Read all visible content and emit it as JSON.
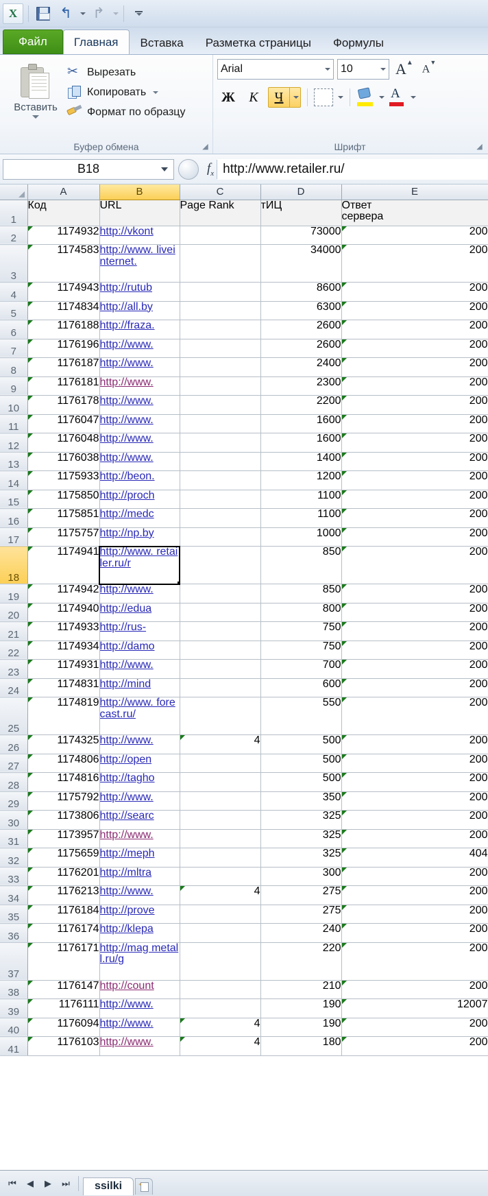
{
  "app": {
    "logo": "X",
    "quick_access": [
      {
        "name": "save-button",
        "label": "Сохранить"
      },
      {
        "name": "undo-button",
        "label": "Отменить"
      },
      {
        "name": "redo-button",
        "label": "Вернуть"
      },
      {
        "name": "customize-qat-button",
        "label": "Настройка панели быстрого доступа"
      }
    ]
  },
  "ribbon": {
    "tabs": [
      {
        "label": "Файл",
        "type": "file"
      },
      {
        "label": "Главная",
        "type": "active"
      },
      {
        "label": "Вставка",
        "type": "normal"
      },
      {
        "label": "Разметка страницы",
        "type": "normal"
      },
      {
        "label": "Формулы",
        "type": "normal"
      }
    ],
    "clipboard": {
      "group_title": "Буфер обмена",
      "paste_label": "Вставить",
      "items": [
        {
          "label": "Вырезать",
          "icon": "scissors-icon",
          "has_menu": false
        },
        {
          "label": "Копировать",
          "icon": "copy-icon",
          "has_menu": true
        },
        {
          "label": "Формат по образцу",
          "icon": "format-painter-icon",
          "has_menu": false
        }
      ]
    },
    "font": {
      "group_title": "Шрифт",
      "font_name": "Arial",
      "font_size": "10",
      "grow_label": "A",
      "shrink_label": "A",
      "bold_label": "Ж",
      "italic_label": "К",
      "underline_label": "Ч",
      "underline_active": true
    }
  },
  "formula_bar": {
    "name_box": "B18",
    "fx_label": "fx",
    "formula_value": "http://www.retailer.ru/"
  },
  "grid": {
    "columns": [
      "A",
      "B",
      "C",
      "D",
      "E"
    ],
    "selected_column": "B",
    "selected_row": 18,
    "selected_cell": "B18",
    "headers": {
      "A": "Код",
      "B": "URL",
      "C": "Page Rank",
      "D": "тИЦ",
      "E": "Ответ\nсервера"
    },
    "rows": [
      {
        "n": 2,
        "a": "1174932",
        "b": "http://vkont",
        "b_visited": false,
        "c": "",
        "d": "73000",
        "e": "200"
      },
      {
        "n": 3,
        "a": "1174583",
        "b": "http://www. liveinternet.",
        "b_visited": false,
        "c": "",
        "d": "34000",
        "e": "200",
        "tall": true
      },
      {
        "n": 4,
        "a": "1174943",
        "b": "http://rutub",
        "b_visited": false,
        "c": "",
        "d": "8600",
        "e": "200"
      },
      {
        "n": 5,
        "a": "1174834",
        "b": "http://all.by",
        "b_visited": false,
        "c": "",
        "d": "6300",
        "e": "200"
      },
      {
        "n": 6,
        "a": "1176188",
        "b": "http://fraza.",
        "b_visited": false,
        "c": "",
        "d": "2600",
        "e": "200"
      },
      {
        "n": 7,
        "a": "1176196",
        "b": "http://www.",
        "b_visited": false,
        "c": "",
        "d": "2600",
        "e": "200"
      },
      {
        "n": 8,
        "a": "1176187",
        "b": "http://www.",
        "b_visited": false,
        "c": "",
        "d": "2400",
        "e": "200"
      },
      {
        "n": 9,
        "a": "1176181",
        "b": "http://www.",
        "b_visited": true,
        "c": "",
        "d": "2300",
        "e": "200"
      },
      {
        "n": 10,
        "a": "1176178",
        "b": "http://www.",
        "b_visited": false,
        "c": "",
        "d": "2200",
        "e": "200"
      },
      {
        "n": 11,
        "a": "1176047",
        "b": "http://www.",
        "b_visited": false,
        "c": "",
        "d": "1600",
        "e": "200"
      },
      {
        "n": 12,
        "a": "1176048",
        "b": "http://www.",
        "b_visited": false,
        "c": "",
        "d": "1600",
        "e": "200"
      },
      {
        "n": 13,
        "a": "1176038",
        "b": "http://www.",
        "b_visited": false,
        "c": "",
        "d": "1400",
        "e": "200"
      },
      {
        "n": 14,
        "a": "1175933",
        "b": "http://beon.",
        "b_visited": false,
        "c": "",
        "d": "1200",
        "e": "200"
      },
      {
        "n": 15,
        "a": "1175850",
        "b": "http://proch",
        "b_visited": false,
        "c": "",
        "d": "1100",
        "e": "200"
      },
      {
        "n": 16,
        "a": "1175851",
        "b": "http://medc",
        "b_visited": false,
        "c": "",
        "d": "1100",
        "e": "200"
      },
      {
        "n": 17,
        "a": "1175757",
        "b": "http://np.by",
        "b_visited": false,
        "c": "",
        "d": "1000",
        "e": "200"
      },
      {
        "n": 18,
        "a": "1174941",
        "b": "http://www. retailer.ru/r",
        "b_visited": false,
        "c": "",
        "d": "850",
        "e": "200",
        "tall": true,
        "selected": true
      },
      {
        "n": 19,
        "a": "1174942",
        "b": "http://www.",
        "b_visited": false,
        "c": "",
        "d": "850",
        "e": "200"
      },
      {
        "n": 20,
        "a": "1174940",
        "b": "http://edua",
        "b_visited": false,
        "c": "",
        "d": "800",
        "e": "200"
      },
      {
        "n": 21,
        "a": "1174933",
        "b": "http://rus-",
        "b_visited": false,
        "c": "",
        "d": "750",
        "e": "200"
      },
      {
        "n": 22,
        "a": "1174934",
        "b": "http://damo",
        "b_visited": false,
        "c": "",
        "d": "750",
        "e": "200"
      },
      {
        "n": 23,
        "a": "1174931",
        "b": "http://www.",
        "b_visited": false,
        "c": "",
        "d": "700",
        "e": "200"
      },
      {
        "n": 24,
        "a": "1174831",
        "b": "http://mind",
        "b_visited": false,
        "c": "",
        "d": "600",
        "e": "200"
      },
      {
        "n": 25,
        "a": "1174819",
        "b": "http://www. forecast.ru/",
        "b_visited": false,
        "c": "",
        "d": "550",
        "e": "200",
        "tall": true
      },
      {
        "n": 26,
        "a": "1174325",
        "b": "http://www.",
        "b_visited": false,
        "c": "4",
        "c_mark": true,
        "d": "500",
        "e": "200"
      },
      {
        "n": 27,
        "a": "1174806",
        "b": "http://open",
        "b_visited": false,
        "c": "",
        "d": "500",
        "e": "200"
      },
      {
        "n": 28,
        "a": "1174816",
        "b": "http://tagho",
        "b_visited": false,
        "c": "",
        "d": "500",
        "e": "200"
      },
      {
        "n": 29,
        "a": "1175792",
        "b": "http://www.",
        "b_visited": false,
        "c": "",
        "d": "350",
        "e": "200"
      },
      {
        "n": 30,
        "a": "1173806",
        "b": "http://searc",
        "b_visited": false,
        "c": "",
        "d": "325",
        "e": "200"
      },
      {
        "n": 31,
        "a": "1173957",
        "b": "http://www.",
        "b_visited": true,
        "c": "",
        "d": "325",
        "e": "200"
      },
      {
        "n": 32,
        "a": "1175659",
        "b": "http://meph",
        "b_visited": false,
        "c": "",
        "d": "325",
        "e": "404"
      },
      {
        "n": 33,
        "a": "1176201",
        "b": "http://mltra",
        "b_visited": false,
        "c": "",
        "d": "300",
        "e": "200"
      },
      {
        "n": 34,
        "a": "1176213",
        "b": "http://www.",
        "b_visited": false,
        "c": "4",
        "c_mark": true,
        "d": "275",
        "e": "200"
      },
      {
        "n": 35,
        "a": "1176184",
        "b": "http://prove",
        "b_visited": false,
        "c": "",
        "d": "275",
        "e": "200"
      },
      {
        "n": 36,
        "a": "1176174",
        "b": "http://klepa",
        "b_visited": false,
        "c": "",
        "d": "240",
        "e": "200"
      },
      {
        "n": 37,
        "a": "1176171",
        "b": "http://mag metall.ru/g",
        "b_visited": false,
        "c": "",
        "d": "220",
        "e": "200",
        "tall": true
      },
      {
        "n": 38,
        "a": "1176147",
        "b": "http://count",
        "b_visited": true,
        "c": "",
        "d": "210",
        "e": "200"
      },
      {
        "n": 39,
        "a": "1176111",
        "b": "http://www.",
        "b_visited": false,
        "c": "",
        "d": "190",
        "e": "12007"
      },
      {
        "n": 40,
        "a": "1176094",
        "b": "http://www.",
        "b_visited": false,
        "c": "4",
        "c_mark": true,
        "d": "190",
        "e": "200"
      },
      {
        "n": 41,
        "a": "1176103",
        "b": "http://www.",
        "b_visited": true,
        "c": "4",
        "c_mark": true,
        "d": "180",
        "e": "200"
      }
    ]
  },
  "sheet_tabs": {
    "nav": [
      "first-sheet",
      "prev-sheet",
      "next-sheet",
      "last-sheet"
    ],
    "active_tab": "ssilki",
    "new_sheet_label": ""
  },
  "colors": {
    "accent_green": "#3f8f17",
    "selection_yellow": "#fbcf56",
    "link_blue": "#2828b8",
    "link_visited": "#8b2a72",
    "error_mark_green": "#1a7a1a"
  }
}
